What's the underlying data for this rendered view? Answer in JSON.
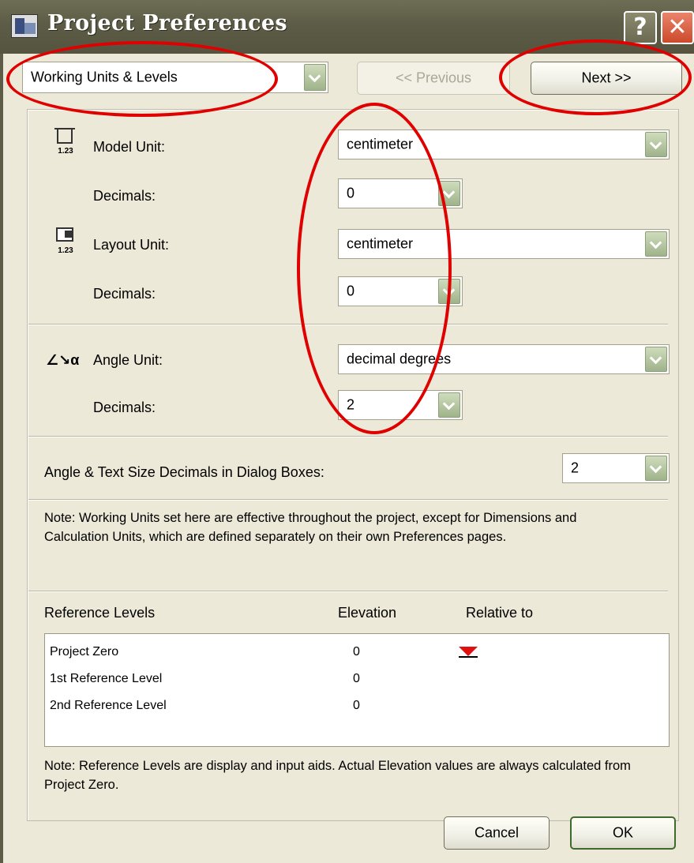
{
  "window": {
    "title": "Project Preferences",
    "help_label": "?",
    "close_label": "✕"
  },
  "nav": {
    "page_select_value": "Working Units & Levels",
    "previous_label": "<< Previous",
    "next_label": "Next >>"
  },
  "units": {
    "model_unit": {
      "label": "Model Unit:",
      "value": "centimeter",
      "icon_text": "1.23"
    },
    "model_decimals": {
      "label": "Decimals:",
      "value": "0"
    },
    "layout_unit": {
      "label": "Layout Unit:",
      "value": "centimeter",
      "icon_text": "1.23"
    },
    "layout_decimals": {
      "label": "Decimals:",
      "value": "0"
    },
    "angle_unit": {
      "label": "Angle Unit:",
      "value": "decimal degrees",
      "icon_text": "∠↘α"
    },
    "angle_decimals": {
      "label": "Decimals:",
      "value": "2"
    },
    "dialog_decimals": {
      "label": "Angle & Text Size Decimals in Dialog Boxes:",
      "value": "2"
    }
  },
  "notes": {
    "units_note": "Note: Working Units set here are effective throughout the project, except for Dimensions and Calculation Units, which are defined separately on their own Preferences pages.",
    "levels_note": "Note: Reference Levels are display and input aids. Actual Elevation values are always calculated from Project Zero."
  },
  "levels": {
    "header_name": "Reference Levels",
    "header_elevation": "Elevation",
    "header_relative": "Relative to",
    "rows": [
      {
        "name": "Project Zero",
        "elevation": "0"
      },
      {
        "name": "1st Reference Level",
        "elevation": "0"
      },
      {
        "name": "2nd Reference Level",
        "elevation": "0"
      }
    ],
    "marker_color": "#e01010"
  },
  "footer": {
    "cancel_label": "Cancel",
    "ok_label": "OK"
  },
  "colors": {
    "dialog_bg": "#ece9d8",
    "titlebar": "#5d5c46",
    "annotation_red": "#e00000"
  }
}
